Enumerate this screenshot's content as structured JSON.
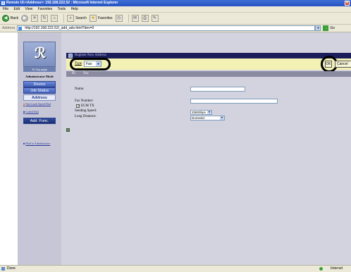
{
  "window": {
    "title": "Remote UI:<Address>: 192.168.222.52 : Microsoft Internet Explorer",
    "close_glyph": "✕"
  },
  "menu": [
    "File",
    "Edit",
    "View",
    "Favorites",
    "Tools",
    "Help"
  ],
  "toolbar": {
    "back_label": "Back",
    "back_glyph": "◀",
    "forward_glyph": "▶",
    "stop_glyph": "✕",
    "refresh_glyph": "↻",
    "home_glyph": "⌂",
    "search_label": "Search",
    "search_glyph": "⌕",
    "favorites_label": "Favorites",
    "favorites_glyph": "★",
    "history_glyph": "◷",
    "mail_glyph": "✉",
    "print_glyph": "⎙",
    "edit_glyph": "✎"
  },
  "addressbar": {
    "label": "Address",
    "url": "http://192.168.222.52/_add_ads.html?dev=0",
    "go_label": "Go",
    "go_glyph": "→",
    "drop_glyph": "▼"
  },
  "sidebar": {
    "logo_glyph": "ℛ",
    "top_page": "To Top page",
    "mode_title": "Administrator Mode",
    "nav": [
      "Device",
      "Job Status",
      "Address",
      "Add. Func."
    ],
    "sub_items": [
      {
        "bullet": "■",
        "label": "One-touch Speed Dial"
      },
      {
        "bullet": "■",
        "label": "Coded Dial"
      }
    ],
    "mail_bullet": "■",
    "mail_label": "Mail to Administrator"
  },
  "main": {
    "header": "Register New Address",
    "type_label": "Type",
    "type_value": "Fax",
    "dd_glyph": "▼",
    "ok_label": "OK",
    "cancel_label": "Cancel",
    "entry_number": "05",
    "entry_kind": "Fax",
    "fields": {
      "name_label": "Name:",
      "name_value": "",
      "fax_number_label": "Fax Number:",
      "fax_number_value": "",
      "ecm_label": "ECM TX",
      "ecm_checked": true,
      "ecm_glyph": "✓",
      "sending_speed_label": "Sending Speed:",
      "sending_speed_value": "33600bps",
      "long_distance_label": "Long Distance:",
      "long_distance_value": "Domestic"
    }
  },
  "status": {
    "left": "Done",
    "zone": "Internet"
  },
  "colors": {
    "accent": "#1a1d5a",
    "type_row": "#f4f1b4",
    "sidebar": "#c6c6d6",
    "main": "#d3d3e0"
  }
}
